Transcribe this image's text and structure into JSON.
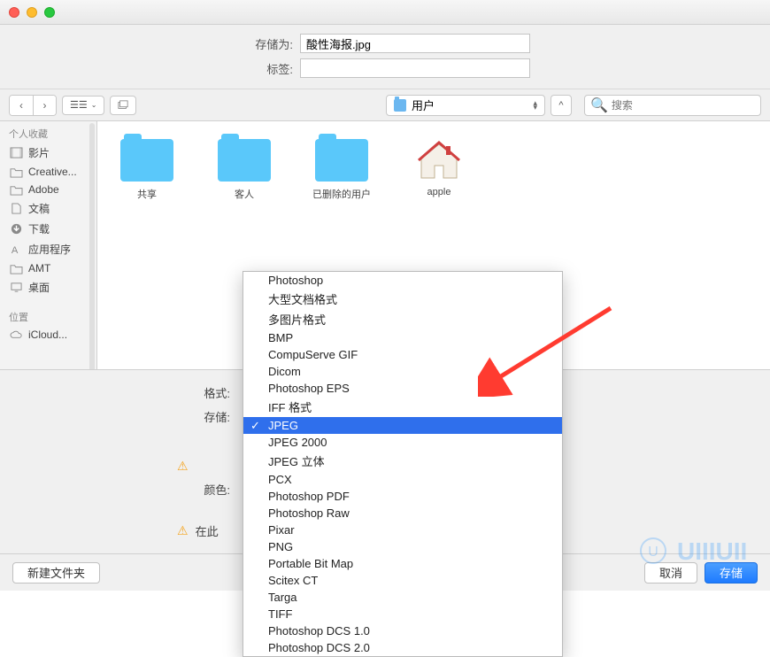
{
  "header": {
    "save_as_label": "存储为:",
    "save_as_value": "酸性海报.jpg",
    "tags_label": "标签:",
    "tags_value": ""
  },
  "toolbar": {
    "path_label": "用户",
    "search_placeholder": "搜索"
  },
  "sidebar": {
    "section_favorites": "个人收藏",
    "items": [
      {
        "label": "影片",
        "icon": "film"
      },
      {
        "label": "Creative...",
        "icon": "folder"
      },
      {
        "label": "Adobe",
        "icon": "folder"
      },
      {
        "label": "文稿",
        "icon": "document"
      },
      {
        "label": "下载",
        "icon": "download"
      },
      {
        "label": "应用程序",
        "icon": "apps"
      },
      {
        "label": "AMT",
        "icon": "folder"
      },
      {
        "label": "桌面",
        "icon": "desktop"
      }
    ],
    "section_locations": "位置",
    "locations": [
      {
        "label": "iCloud...",
        "icon": "cloud"
      }
    ]
  },
  "files": [
    {
      "label": "共享",
      "type": "folder"
    },
    {
      "label": "客人",
      "type": "folder"
    },
    {
      "label": "已删除的用户",
      "type": "folder"
    },
    {
      "label": "apple",
      "type": "home"
    }
  ],
  "options": {
    "format_label": "格式:",
    "storage_label": "存储:",
    "color_label": "颜色:",
    "here_label": "在此"
  },
  "dropdown": {
    "items": [
      "Photoshop",
      "大型文档格式",
      "多图片格式",
      "BMP",
      "CompuServe GIF",
      "Dicom",
      "Photoshop EPS",
      "IFF 格式",
      "JPEG",
      "JPEG 2000",
      "JPEG 立体",
      "PCX",
      "Photoshop PDF",
      "Photoshop Raw",
      "Pixar",
      "PNG",
      "Portable Bit Map",
      "Scitex CT",
      "Targa",
      "TIFF",
      "Photoshop DCS 1.0",
      "Photoshop DCS 2.0"
    ],
    "selected": "JPEG"
  },
  "footer": {
    "new_folder": "新建文件夹",
    "cancel": "取消",
    "save": "存储"
  }
}
